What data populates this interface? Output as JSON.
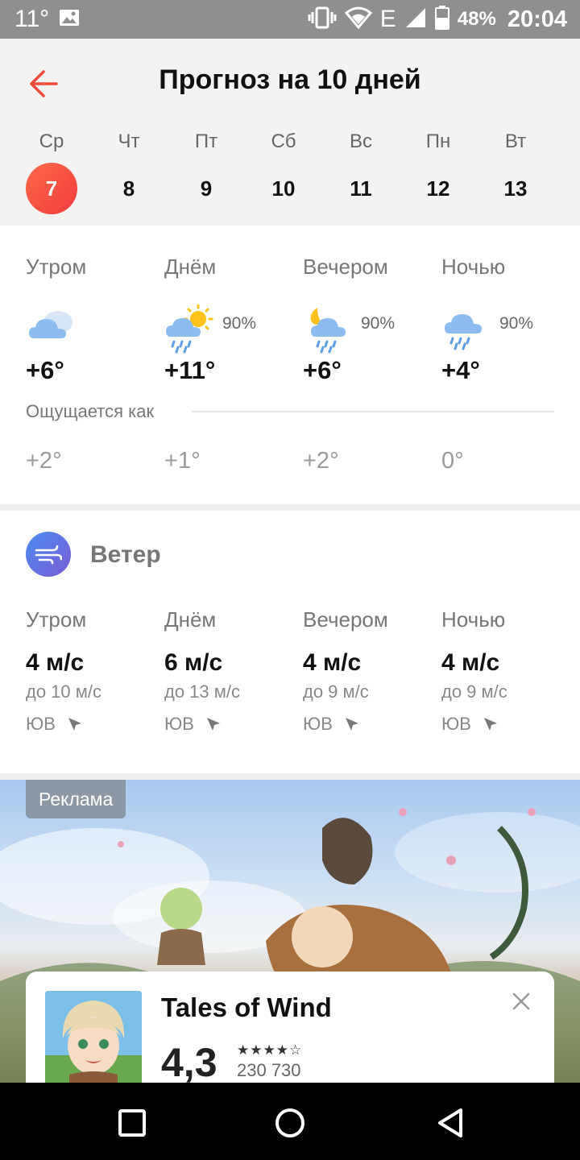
{
  "status_bar": {
    "temperature": "11°",
    "battery_percent": "48%",
    "time": "20:04",
    "network_label": "E",
    "icons": [
      "image-icon",
      "vibrate-icon",
      "wifi-icon",
      "signal-icon",
      "battery-icon"
    ]
  },
  "header": {
    "title": "Прогноз на 10 дней",
    "back_icon": "arrow-left-icon",
    "accent_color": "#f04c3e",
    "days": [
      {
        "name": "Ср",
        "num": "7",
        "selected": true
      },
      {
        "name": "Чт",
        "num": "8"
      },
      {
        "name": "Пт",
        "num": "9"
      },
      {
        "name": "Сб",
        "num": "10"
      },
      {
        "name": "Вс",
        "num": "11"
      },
      {
        "name": "Пн",
        "num": "12"
      },
      {
        "name": "Вт",
        "num": "13"
      }
    ]
  },
  "forecast": {
    "parts": [
      {
        "label": "Утром",
        "icon": "cloudy-icon",
        "precip": "",
        "temp": "+6°",
        "feels": "+2°"
      },
      {
        "label": "Днём",
        "icon": "sun-cloud-rain-icon",
        "precip": "90%",
        "temp": "+11°",
        "feels": "+1°"
      },
      {
        "label": "Вечером",
        "icon": "moon-cloud-rain-icon",
        "precip": "90%",
        "temp": "+6°",
        "feels": "+2°"
      },
      {
        "label": "Ночью",
        "icon": "cloud-rain-icon",
        "precip": "90%",
        "temp": "+4°",
        "feels": "0°"
      }
    ],
    "feels_like_label": "Ощущается как"
  },
  "wind": {
    "title": "Ветер",
    "icon": "wind-icon",
    "parts": [
      {
        "label": "Утром",
        "speed": "4 м/с",
        "gust": "до 10 м/с",
        "direction": "ЮВ"
      },
      {
        "label": "Днём",
        "speed": "6 м/с",
        "gust": "до 13 м/с",
        "direction": "ЮВ"
      },
      {
        "label": "Вечером",
        "speed": "4 м/с",
        "gust": "до 9 м/с",
        "direction": "ЮВ"
      },
      {
        "label": "Ночью",
        "speed": "4 м/с",
        "gust": "до 9 м/с",
        "direction": "ЮВ"
      }
    ]
  },
  "ad": {
    "badge": "Реклама",
    "app_name": "Tales of Wind",
    "rating": "4,3",
    "reviews": "230 730",
    "stars": "★★★★☆",
    "close_icon": "close-icon"
  },
  "nav_bar": {
    "icons": [
      "recent-apps-icon",
      "home-icon",
      "back-icon"
    ]
  }
}
